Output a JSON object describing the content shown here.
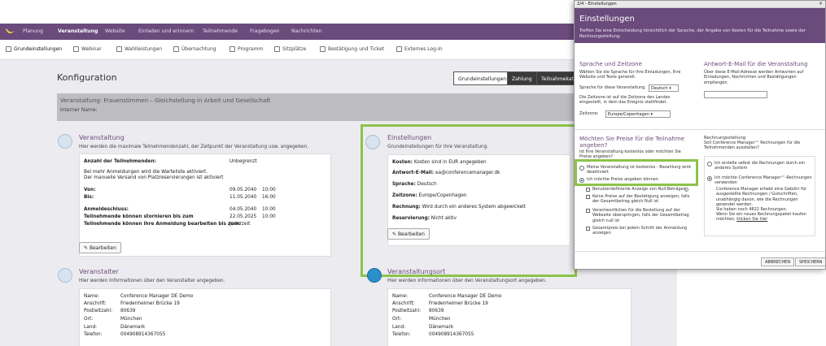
{
  "topnav": {
    "items": [
      "Planung",
      "Veranstaltung",
      "Website",
      "Einladen und erinnern",
      "Teilnehmende",
      "Fragebogen",
      "Nachrichten"
    ]
  },
  "subnav": {
    "items": [
      {
        "label": "Grundeinstellungen",
        "icon": "gear-icon"
      },
      {
        "label": "Webinar",
        "icon": "video-icon"
      },
      {
        "label": "Wahlleistungen",
        "icon": "options-icon"
      },
      {
        "label": "Übernachtung",
        "icon": "hotel-icon"
      },
      {
        "label": "Programm",
        "icon": "calendar-icon"
      },
      {
        "label": "Sitzplätze",
        "icon": "seat-icon"
      },
      {
        "label": "Bestätigung und Ticket",
        "icon": "ticket-icon"
      },
      {
        "label": "Externes Log-In",
        "icon": "login-icon"
      }
    ]
  },
  "page": {
    "title": "Konfiguration",
    "tabs": [
      "Grundeinstellungen",
      "Zahlung",
      "Teilnahmekat"
    ]
  },
  "event_bar": {
    "title": "Veranstaltung: Frauenstimmen – Gleichstellung in Arbeit und Gesellschaft",
    "internal_name": "Interner Name:"
  },
  "veranstaltung": {
    "title": "Veranstaltung",
    "desc": "Hier werden die maximale Teilnehmendenzahl, der Zeitpunkt der Veranstaltung usw. angegeben.",
    "max_label": "Anzahl der Teilnehmenden:",
    "max_value": "Unbegrenzt",
    "note1": "Bei mehr Anmeldungen wird die Warteliste aktiviert.",
    "note2": "Der manuelle Versand von Platzreservierungen ist aktiviert",
    "von_label": "Von:",
    "von_date": "09.05.2040",
    "von_time": "10:00",
    "bis_label": "Bis:",
    "bis_date": "11.05.2040",
    "bis_time": "16:00",
    "anm_label": "Anmeldeschluss:",
    "anm_date": "04.05.2040",
    "anm_time": "10:00",
    "storno_label": "Teilnehmende können stornieren bis zum",
    "storno_date": "22.05.2025",
    "storno_time": "10:00",
    "edit_label": "Teilnehmende können ihre Anmeldung bearbeiten bis zum:",
    "edit_value": "Jederzeit",
    "button": "Bearbeiten"
  },
  "einstellungen": {
    "title": "Einstellungen",
    "desc": "Grundeinstellungen für Ihre Veranstaltung.",
    "kosten_label": "Kosten:",
    "kosten_value": "Kosten sind in EUR angegeben",
    "email_label": "Antwort-E-Mail:",
    "email_value": "ea@conferencemanager.dk",
    "sprache_label": "Sprache:",
    "sprache_value": "Deutsch",
    "zone_label": "Zeitzone:",
    "zone_value": "Europe/Copenhagen",
    "rech_label": "Rechnung:",
    "rech_value": "Wird durch ein anderes System abgewickelt",
    "res_label": "Reservierung:",
    "res_value": "Nicht aktiv",
    "button": "Bearbeiten"
  },
  "veranstalter": {
    "title": "Veranstalter",
    "desc": "Hier werden Informationen über den Veranstalter angegeben.",
    "rows": [
      {
        "k": "Name:",
        "v": "Conference Manager DE Demo"
      },
      {
        "k": "Anschrift:",
        "v": "Friedenheimer Brücke 19"
      },
      {
        "k": "Postleitzahl:",
        "v": "80639"
      },
      {
        "k": "Ort:",
        "v": "München"
      },
      {
        "k": "Land:",
        "v": "Dänemark"
      },
      {
        "k": "Telefon:",
        "v": "004908914367055"
      }
    ]
  },
  "veranstaltungsort": {
    "title": "Veranstaltungsort",
    "desc": "Hier werden Informationen über den Veranstaltungsort angegeben.",
    "rows": [
      {
        "k": "Name:",
        "v": "Conference Manager DE Demo"
      },
      {
        "k": "Anschrift:",
        "v": "Friedenheimer Brücke 19"
      },
      {
        "k": "Postleitzahl:",
        "v": "80639"
      },
      {
        "k": "Ort:",
        "v": "München"
      },
      {
        "k": "Land:",
        "v": "Dänemark"
      },
      {
        "k": "Telefon:",
        "v": "004908914367055"
      }
    ]
  },
  "dialog": {
    "window_title": "2/4 - Einstellungen",
    "close": "×",
    "heading": "Einstellungen",
    "subheading": "Treffen Sie eine Entscheidung hinsichtlich der Sprache, der Angabe von Kosten für die Teilnahme sowie der Rechnungsstellung.",
    "lang_title": "Sprache und Zeitzone",
    "lang_desc": "Wählen Sie die Sprache für Ihre Einladungen, Ihre Website und Texte generell.",
    "lang_label": "Sprache für diese Veranstaltung",
    "lang_value": "Deutsch",
    "tz_desc": "Die Zeitzone ist auf die Zeitzone des Landes eingestellt, in dem das Ereignis stattfindet.",
    "tz_label": "Zeitzone:",
    "tz_value": "Europe/Copenhagen",
    "reply_title": "Antwort-E-Mail für die Veranstaltung",
    "reply_desc": "Über diese E-Mail-Adresse werden Antworten auf Einladungen, Nachrichten und Bestätigungen empfangen.",
    "price_title": "Möchten Sie Preise für die Teilnahme angeben?",
    "price_q": "Ist Ihre Veranstaltung kostenlos oder möchten Sie Preise angeben?",
    "opt_free": "Meine Veranstaltung ist kostenlos - Bezahlung wird deaktiviert",
    "opt_prices": "Ich möchte Preise angeben können",
    "chk1": "Benutzerdefinierte Anzeige von Null-Beträgen",
    "chk2": "Keine Preise auf der Bestätigung anzeigen, falls der Gesamtbetrag gleich Null ist",
    "chk3": "Verantwortlichen für die Bestellung auf der Webseite überspringen, falls der Gesamtbetrag gleich null ist",
    "chk4": "Gesamtpreis bei jedem Schritt der Anmeldung anzeigen",
    "inv_title": "Rechnungsstellung",
    "inv_q": "Soll Conference Manager™ Rechnungen für die Teilnehmenden ausstellen?",
    "inv_opt1": "Ich erstelle selbst die Rechnungen durch ein anderes System",
    "inv_opt2": "Ich möchte Conference Manager™-Rechnungen verwenden",
    "inv_note": "Conference Manager erhebt eine Gebühr für ausgestellte Rechnungen / Gutschriften, unabhängig davon, wie die Rechnungen gesendet werden.",
    "inv_count": "Sie haben noch 4822 Rechnungen.",
    "inv_buy": "Wenn Sie ein neues Rechnungspaket kaufen möchten,",
    "inv_link": "klicken Sie hier",
    "cancel": "ABBRECHEN",
    "save": "SPEICHERN"
  },
  "colors": {
    "brand": "#6b4a7c",
    "highlight": "#8bc34a"
  }
}
